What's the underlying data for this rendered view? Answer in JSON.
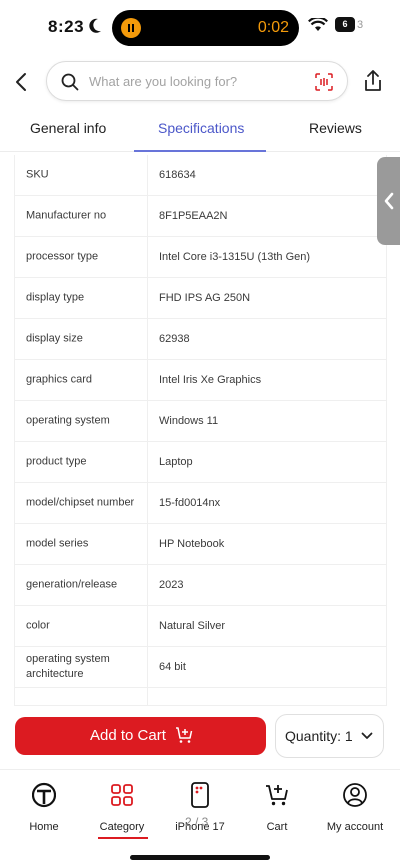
{
  "status_bar": {
    "time": "8:23",
    "timer": "0:02",
    "battery": "6",
    "battery_extra": "3"
  },
  "search": {
    "placeholder": "What are you looking for?"
  },
  "tabs": [
    {
      "label": "General info",
      "active": false
    },
    {
      "label": "Specifications",
      "active": true
    },
    {
      "label": "Reviews",
      "active": false
    }
  ],
  "specs": [
    {
      "label": "SKU",
      "value": "618634"
    },
    {
      "label": "Manufacturer no",
      "value": "8F1P5EAA2N"
    },
    {
      "label": "processor type",
      "value": "Intel Core i3-1315U (13th Gen)"
    },
    {
      "label": "display type",
      "value": "FHD IPS AG 250N"
    },
    {
      "label": "display size",
      "value": "62938"
    },
    {
      "label": "graphics card",
      "value": "Intel Iris Xe Graphics"
    },
    {
      "label": "operating system",
      "value": "Windows 11"
    },
    {
      "label": "product type",
      "value": "Laptop"
    },
    {
      "label": "model/chipset number",
      "value": "15-fd0014nx"
    },
    {
      "label": "model series",
      "value": "HP Notebook"
    },
    {
      "label": "generation/release",
      "value": "2023"
    },
    {
      "label": "color",
      "value": "Natural Silver"
    },
    {
      "label": "operating system architecture",
      "value": "64 bit"
    }
  ],
  "actions": {
    "add_to_cart": "Add to Cart",
    "quantity": "Quantity: 1"
  },
  "bottom_nav": [
    {
      "label": "Home"
    },
    {
      "label": "Category"
    },
    {
      "label": "iPhone 17"
    },
    {
      "label": "Cart"
    },
    {
      "label": "My account"
    }
  ],
  "page_indicator": "2 / 3",
  "colors": {
    "accent_red": "#dc1b21",
    "tab_active": "#4b57c9",
    "timer_orange": "#f39a0b"
  }
}
